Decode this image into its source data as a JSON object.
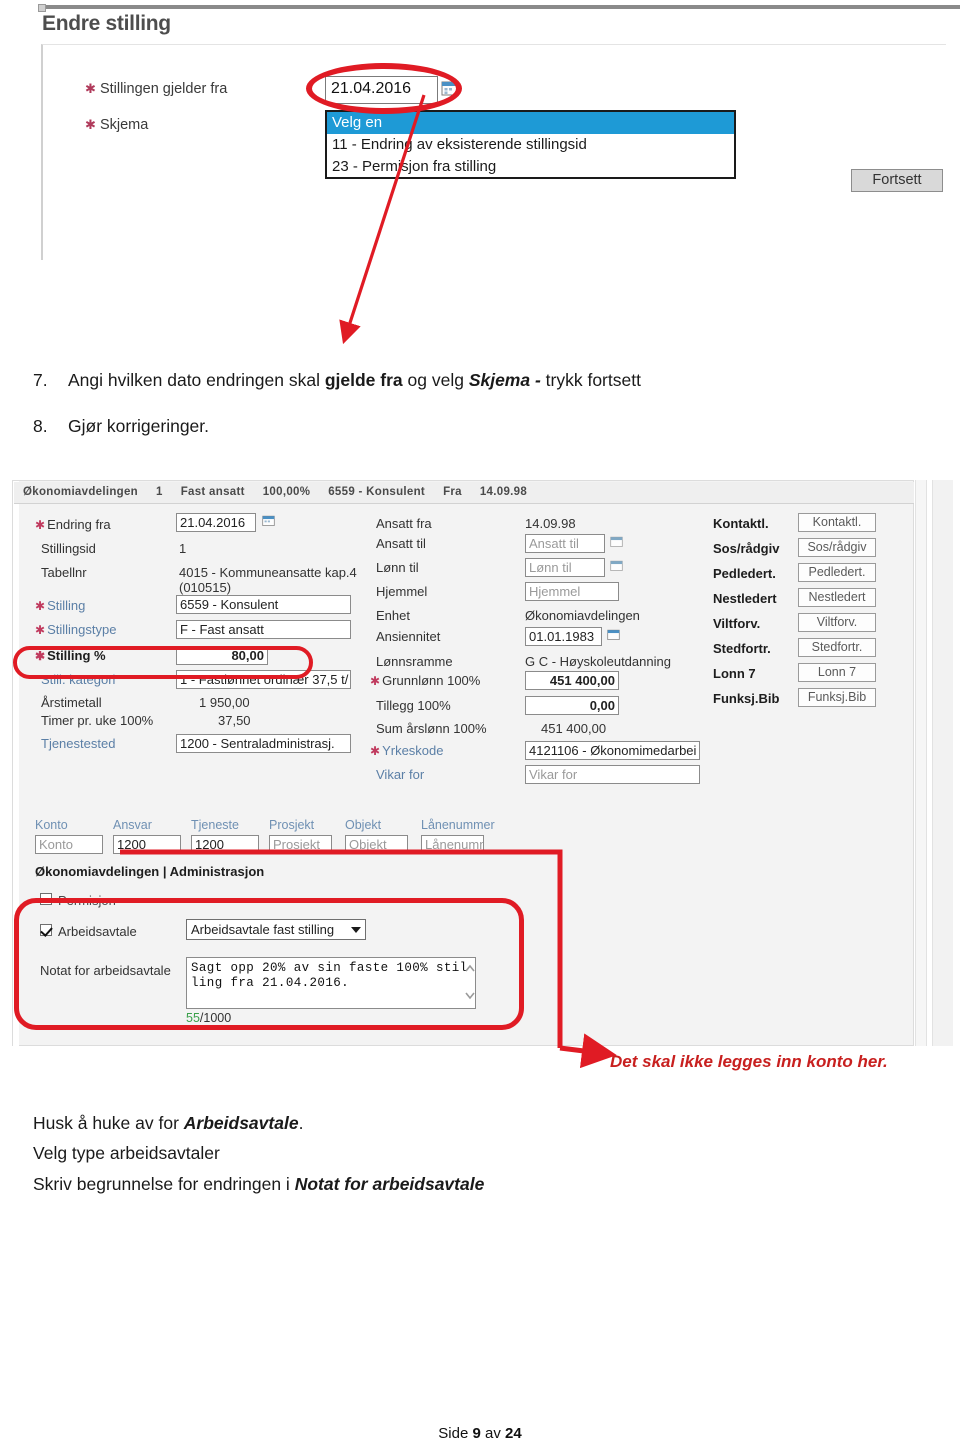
{
  "top_screenshot": {
    "window_title": "Endre stilling",
    "fields": [
      {
        "label": "Stillingen gjelder fra",
        "required": true
      },
      {
        "label": "Skjema",
        "required": true
      }
    ],
    "date_value": "21.04.2016",
    "calendar_icon": "calendar-icon",
    "select_options": [
      "Velg en",
      "11 - Endring av eksisterende stillingsid",
      "23 - Permisjon fra stilling"
    ],
    "selected_option_index": 0,
    "continue_button": "Fortsett"
  },
  "steps": [
    {
      "number": "7.",
      "parts": [
        {
          "text": "Angi hvilken dato endringen skal ",
          "style": "normal"
        },
        {
          "text": "gjelde fra",
          "style": "bold"
        },
        {
          "text": " og velg ",
          "style": "normal"
        },
        {
          "text": "Skjema -",
          "style": "bolditalic"
        },
        {
          "text": " trykk fortsett",
          "style": "normal"
        }
      ]
    },
    {
      "number": "8.",
      "parts": [
        {
          "text": "Gjør korrigeringer.",
          "style": "normal"
        }
      ]
    }
  ],
  "form": {
    "header_chips": [
      "Økonomiavdelingen",
      "1",
      "Fast ansatt",
      "100,00%",
      "6559 - Konsulent",
      "Fra",
      "14.09.98"
    ],
    "left_column": [
      {
        "label": "Endring fra",
        "required": true,
        "style": "normal",
        "control": "input",
        "value": "21.04.2016",
        "calendar": true
      },
      {
        "label": "Stillingsid",
        "required": false,
        "style": "normal",
        "control": "text",
        "value": "1"
      },
      {
        "label": "Tabellnr",
        "required": false,
        "style": "normal",
        "control": "text",
        "value": "4015 - Kommuneansatte kap.4",
        "value2": "(010515)"
      },
      {
        "label": "Stilling",
        "required": true,
        "style": "blue",
        "control": "input",
        "value": "6559 - Konsulent"
      },
      {
        "label": "Stillingstype",
        "required": true,
        "style": "blue",
        "control": "input",
        "value": "F - Fast ansatt"
      },
      {
        "label": "Stilling %",
        "required": true,
        "style": "bold",
        "control": "input",
        "value": "80,00",
        "align": "right"
      },
      {
        "label": "Still. kategori",
        "required": false,
        "style": "blue",
        "control": "input",
        "value": "1 - Fastlønnet ordinær 37,5 t/"
      },
      {
        "label": "Årstimetall",
        "required": false,
        "style": "normal",
        "control": "text",
        "value": "1 950,00"
      },
      {
        "label": "Timer pr. uke 100%",
        "required": false,
        "style": "normal",
        "control": "text",
        "value": "37,50"
      },
      {
        "label": "Tjenestested",
        "required": false,
        "style": "blue",
        "control": "input",
        "value": "1200 - Sentraladministrasj."
      }
    ],
    "middle_column": [
      {
        "label": "Ansatt fra",
        "required": false,
        "style": "normal",
        "control": "text",
        "value": "14.09.98"
      },
      {
        "label": "Ansatt til",
        "required": false,
        "style": "normal",
        "control": "placeholder",
        "value": "Ansatt til",
        "calendar": true
      },
      {
        "label": "Lønn til",
        "required": false,
        "style": "normal",
        "control": "placeholder",
        "value": "Lønn til",
        "calendar": true
      },
      {
        "label": "Hjemmel",
        "required": false,
        "style": "normal",
        "control": "placeholder",
        "value": "Hjemmel"
      },
      {
        "label": "Enhet",
        "required": false,
        "style": "normal",
        "control": "text",
        "value": "Økonomiavdelingen"
      },
      {
        "label": "Ansiennitet",
        "required": false,
        "style": "normal",
        "control": "input",
        "value": "01.01.1983",
        "calendar": true
      },
      {
        "label": "Lønnsramme",
        "required": false,
        "style": "normal",
        "control": "text",
        "value": "G C - Høyskoleutdanning"
      },
      {
        "label": "Grunnlønn 100%",
        "required": true,
        "style": "normal",
        "control": "input",
        "value": "451 400,00",
        "align": "right"
      },
      {
        "label": "Tillegg 100%",
        "required": false,
        "style": "normal",
        "control": "input",
        "value": "0,00",
        "align": "right"
      },
      {
        "label": "Sum årslønn 100%",
        "required": false,
        "style": "normal",
        "control": "text",
        "value": "451 400,00"
      },
      {
        "label": "Yrkeskode",
        "required": true,
        "style": "blue",
        "control": "input",
        "value": "4121106 - Økonomimedarbei"
      },
      {
        "label": "Vikar for",
        "required": false,
        "style": "blue",
        "control": "placeholder",
        "value": "Vikar for"
      }
    ],
    "right_column": [
      {
        "label": "Kontaktl.",
        "button": "Kontaktl."
      },
      {
        "label": "Sos/rådgiv",
        "button": "Sos/rådgiv"
      },
      {
        "label": "Pedledert.",
        "button": "Pedledert."
      },
      {
        "label": "Nestledert",
        "button": "Nestledert"
      },
      {
        "label": "Viltforv.",
        "button": "Viltforv."
      },
      {
        "label": "Stedfortr.",
        "button": "Stedfortr."
      },
      {
        "label": "Lonn 7",
        "button": "Lonn 7"
      },
      {
        "label": "Funksj.Bib",
        "button": "Funksj.Bib"
      }
    ],
    "account_row": {
      "headers": [
        "Konto",
        "Ansvar",
        "Tjeneste",
        "Prosjekt",
        "Objekt",
        "Lånenummer"
      ],
      "values": [
        "Konto",
        "1200",
        "1200",
        "Prosjekt",
        "Objekt",
        "Lånenumm"
      ],
      "filled": [
        false,
        true,
        true,
        false,
        false,
        false
      ],
      "caption": "Økonomiavdelingen | Administrasjon"
    },
    "agreement": {
      "permisjon_label": "Permisjon",
      "permisjon_checked": false,
      "arbeidsavtale_label": "Arbeidsavtale",
      "arbeidsavtale_checked": true,
      "type_selected": "Arbeidsavtale fast stilling",
      "note_label": "Notat for arbeidsavtale",
      "note_value": "Sagt opp 20% av sin faste 100% stil\nling fra 21.04.2016.",
      "counter_current": "55",
      "counter_max": "/1000"
    }
  },
  "annotations": {
    "konto_warning": "Det skal ikke legges inn konto her."
  },
  "bottom_text": {
    "lines": [
      [
        {
          "text": "Husk å huke av for ",
          "style": "normal"
        },
        {
          "text": "Arbeidsavtale",
          "style": "bolditalic"
        },
        {
          "text": ".",
          "style": "normal"
        }
      ],
      [
        {
          "text": "Velg type arbeidsavtaler",
          "style": "normal"
        }
      ],
      [
        {
          "text": "Skriv begrunnelse for endringen i ",
          "style": "normal"
        },
        {
          "text": "Notat for arbeidsavtale",
          "style": "bolditalic"
        }
      ]
    ]
  },
  "footer": {
    "prefix": "Side ",
    "page": "9",
    "middle": " av ",
    "total": "24"
  },
  "colors": {
    "annotation_red": "#e01b24",
    "note_red": "#c8201f",
    "select_highlight": "#1e9ad6",
    "label_blue": "#5b7fa6",
    "required_star": "#c03a5e"
  }
}
